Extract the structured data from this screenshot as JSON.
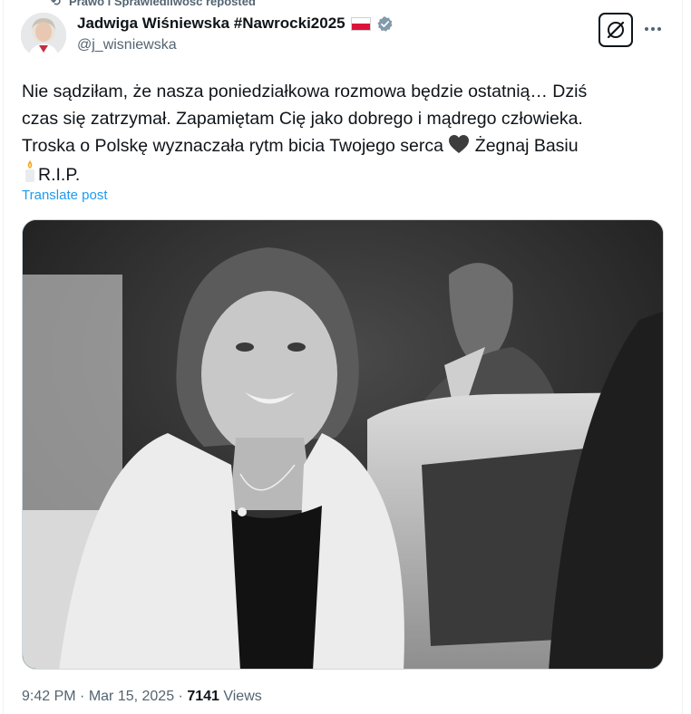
{
  "repost": {
    "text": "Prawo i Sprawiedliwość reposted"
  },
  "author": {
    "display_name": "Jadwiga Wiśniewska #Nawrocki2025",
    "handle": "@j_wisniewska",
    "verified": true,
    "flag": "poland-flag"
  },
  "actions": {
    "grok_icon": "grok-icon",
    "more_icon": "more-icon"
  },
  "tweet": {
    "line1": "Nie sądziłam, że nasza poniedziałkowa rozmowa będzie ostatnią… Dziś",
    "line2": "czas się zatrzymał. Zapamiętam Cię jako dobrego i mądrego człowieka.",
    "line3": "Troska o Polskę wyznaczała rytm bicia Twojego serca",
    "line3_end": "Żegnaj Basiu",
    "line4": "R.I.P.",
    "emoji_heart": "black-heart-icon",
    "emoji_candle": "candle-icon"
  },
  "translate_label": "Translate post",
  "media": {
    "kind": "black-and-white photo"
  },
  "meta": {
    "time": "9:42 PM",
    "sep1": " · ",
    "date": "Mar 15, 2025",
    "sep2": " · ",
    "views_count": "7141",
    "views_label": " Views"
  },
  "colors": {
    "link": "#1d9bf0",
    "secondary_text": "#536471",
    "verified": "#829aab",
    "flag_red": "#dc143c"
  }
}
